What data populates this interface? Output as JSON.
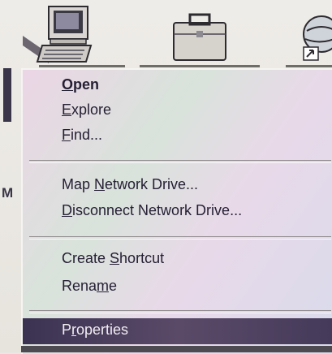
{
  "context_menu": {
    "items": [
      {
        "pre": "",
        "acc": "O",
        "post": "pen",
        "bold": true
      },
      {
        "pre": "",
        "acc": "E",
        "post": "xplore",
        "bold": false
      },
      {
        "pre": "",
        "acc": "F",
        "post": "ind...",
        "bold": false
      },
      {
        "pre": "Map ",
        "acc": "N",
        "post": "etwork Drive...",
        "bold": false
      },
      {
        "pre": "",
        "acc": "D",
        "post": "isconnect Network Drive...",
        "bold": false
      },
      {
        "pre": "Create ",
        "acc": "S",
        "post": "hortcut",
        "bold": false
      },
      {
        "pre": "Rena",
        "acc": "m",
        "post": "e",
        "bold": false
      },
      {
        "pre": "P",
        "acc": "r",
        "post": "operties",
        "bold": false,
        "highlighted": true
      }
    ]
  },
  "desktop": {
    "icons": [
      "computer-icon",
      "briefcase-icon",
      "network-shortcut-icon"
    ],
    "stub_labels": [
      "",
      "M"
    ]
  },
  "colors": {
    "highlight": "#3b3252",
    "menu_text": "#262035",
    "desktop": "#e9e7e2"
  }
}
